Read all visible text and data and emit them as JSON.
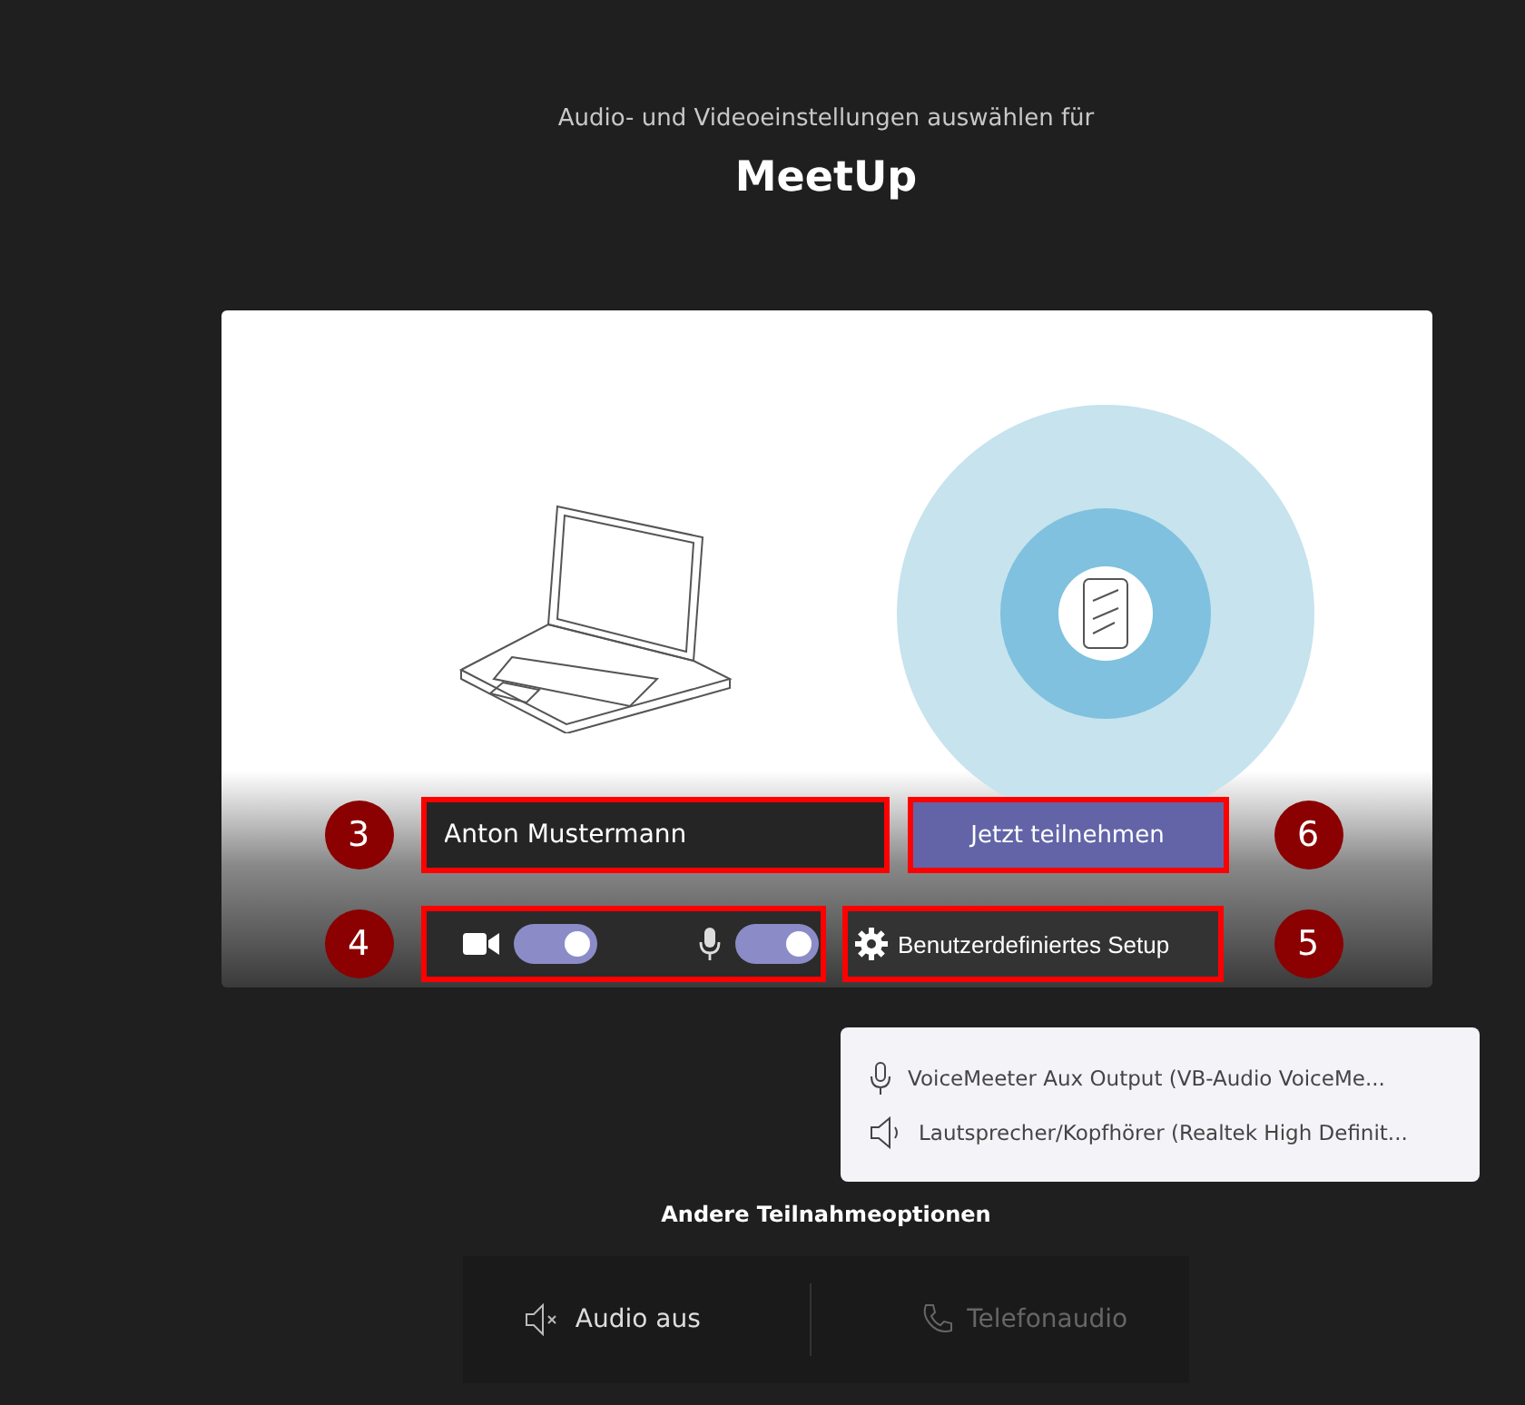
{
  "header": {
    "subtitle": "Audio- und Videoeinstellungen auswählen für",
    "meeting_title": "MeetUp"
  },
  "preview": {
    "name_field": {
      "value": "Anton Mustermann"
    },
    "join_button": "Jetzt teilnehmen",
    "camera": {
      "on": true
    },
    "microphone": {
      "on": true
    },
    "setup_button": "Benutzerdefiniertes Setup"
  },
  "annotations": [
    {
      "label": "3"
    },
    {
      "label": "6"
    },
    {
      "label": "4"
    },
    {
      "label": "5"
    }
  ],
  "device_menu": [
    {
      "kind": "microphone",
      "label": "VoiceMeeter Aux Output (VB-Audio VoiceMe..."
    },
    {
      "kind": "speaker",
      "label": "Lautsprecher/Kopfhörer (Realtek High Definit..."
    }
  ],
  "other_options": {
    "title": "Andere Teilnahmeoptionen",
    "options": [
      {
        "kind": "audio-off",
        "label": "Audio aus",
        "disabled": false
      },
      {
        "kind": "phone",
        "label": "Telefonaudio",
        "disabled": true
      }
    ]
  }
}
